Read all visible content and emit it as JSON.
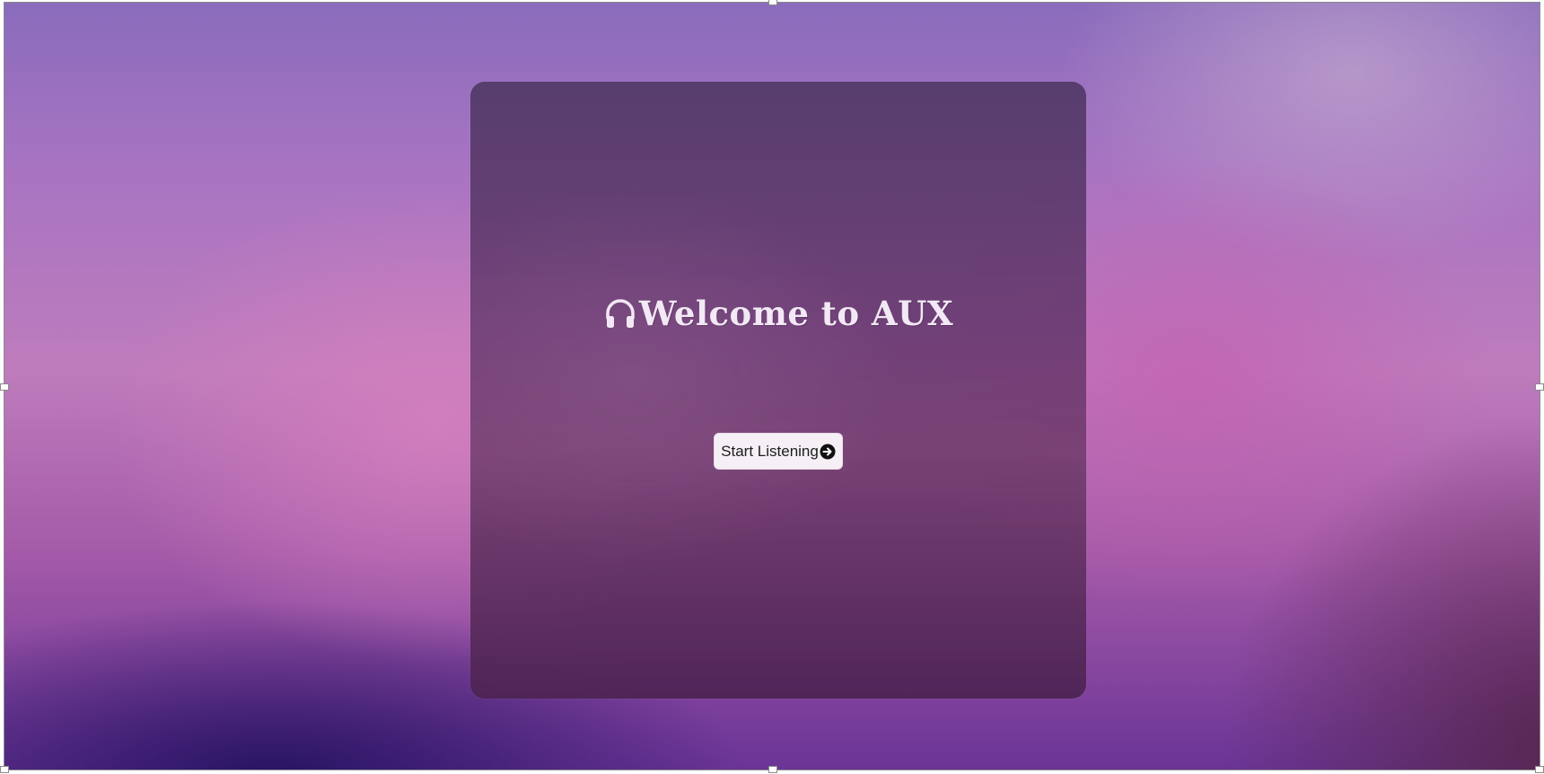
{
  "card": {
    "title": "Welcome to AUX",
    "title_icon": "headphones-icon"
  },
  "start_button": {
    "label": "Start Listening",
    "icon": "arrow-circle-right-icon"
  },
  "colors": {
    "card_text": "#f3e8f5",
    "button_bg": "#f6eff6",
    "button_text": "#1c1c1c"
  }
}
